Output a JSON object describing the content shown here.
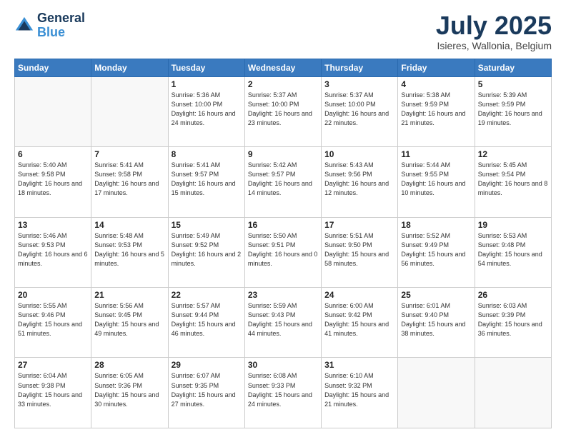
{
  "header": {
    "logo_line1": "General",
    "logo_line2": "Blue",
    "month": "July 2025",
    "location": "Isieres, Wallonia, Belgium"
  },
  "days_of_week": [
    "Sunday",
    "Monday",
    "Tuesday",
    "Wednesday",
    "Thursday",
    "Friday",
    "Saturday"
  ],
  "weeks": [
    [
      {
        "day": "",
        "info": ""
      },
      {
        "day": "",
        "info": ""
      },
      {
        "day": "1",
        "info": "Sunrise: 5:36 AM\nSunset: 10:00 PM\nDaylight: 16 hours\nand 24 minutes."
      },
      {
        "day": "2",
        "info": "Sunrise: 5:37 AM\nSunset: 10:00 PM\nDaylight: 16 hours\nand 23 minutes."
      },
      {
        "day": "3",
        "info": "Sunrise: 5:37 AM\nSunset: 10:00 PM\nDaylight: 16 hours\nand 22 minutes."
      },
      {
        "day": "4",
        "info": "Sunrise: 5:38 AM\nSunset: 9:59 PM\nDaylight: 16 hours\nand 21 minutes."
      },
      {
        "day": "5",
        "info": "Sunrise: 5:39 AM\nSunset: 9:59 PM\nDaylight: 16 hours\nand 19 minutes."
      }
    ],
    [
      {
        "day": "6",
        "info": "Sunrise: 5:40 AM\nSunset: 9:58 PM\nDaylight: 16 hours\nand 18 minutes."
      },
      {
        "day": "7",
        "info": "Sunrise: 5:41 AM\nSunset: 9:58 PM\nDaylight: 16 hours\nand 17 minutes."
      },
      {
        "day": "8",
        "info": "Sunrise: 5:41 AM\nSunset: 9:57 PM\nDaylight: 16 hours\nand 15 minutes."
      },
      {
        "day": "9",
        "info": "Sunrise: 5:42 AM\nSunset: 9:57 PM\nDaylight: 16 hours\nand 14 minutes."
      },
      {
        "day": "10",
        "info": "Sunrise: 5:43 AM\nSunset: 9:56 PM\nDaylight: 16 hours\nand 12 minutes."
      },
      {
        "day": "11",
        "info": "Sunrise: 5:44 AM\nSunset: 9:55 PM\nDaylight: 16 hours\nand 10 minutes."
      },
      {
        "day": "12",
        "info": "Sunrise: 5:45 AM\nSunset: 9:54 PM\nDaylight: 16 hours\nand 8 minutes."
      }
    ],
    [
      {
        "day": "13",
        "info": "Sunrise: 5:46 AM\nSunset: 9:53 PM\nDaylight: 16 hours\nand 6 minutes."
      },
      {
        "day": "14",
        "info": "Sunrise: 5:48 AM\nSunset: 9:53 PM\nDaylight: 16 hours\nand 5 minutes."
      },
      {
        "day": "15",
        "info": "Sunrise: 5:49 AM\nSunset: 9:52 PM\nDaylight: 16 hours\nand 2 minutes."
      },
      {
        "day": "16",
        "info": "Sunrise: 5:50 AM\nSunset: 9:51 PM\nDaylight: 16 hours\nand 0 minutes."
      },
      {
        "day": "17",
        "info": "Sunrise: 5:51 AM\nSunset: 9:50 PM\nDaylight: 15 hours\nand 58 minutes."
      },
      {
        "day": "18",
        "info": "Sunrise: 5:52 AM\nSunset: 9:49 PM\nDaylight: 15 hours\nand 56 minutes."
      },
      {
        "day": "19",
        "info": "Sunrise: 5:53 AM\nSunset: 9:48 PM\nDaylight: 15 hours\nand 54 minutes."
      }
    ],
    [
      {
        "day": "20",
        "info": "Sunrise: 5:55 AM\nSunset: 9:46 PM\nDaylight: 15 hours\nand 51 minutes."
      },
      {
        "day": "21",
        "info": "Sunrise: 5:56 AM\nSunset: 9:45 PM\nDaylight: 15 hours\nand 49 minutes."
      },
      {
        "day": "22",
        "info": "Sunrise: 5:57 AM\nSunset: 9:44 PM\nDaylight: 15 hours\nand 46 minutes."
      },
      {
        "day": "23",
        "info": "Sunrise: 5:59 AM\nSunset: 9:43 PM\nDaylight: 15 hours\nand 44 minutes."
      },
      {
        "day": "24",
        "info": "Sunrise: 6:00 AM\nSunset: 9:42 PM\nDaylight: 15 hours\nand 41 minutes."
      },
      {
        "day": "25",
        "info": "Sunrise: 6:01 AM\nSunset: 9:40 PM\nDaylight: 15 hours\nand 38 minutes."
      },
      {
        "day": "26",
        "info": "Sunrise: 6:03 AM\nSunset: 9:39 PM\nDaylight: 15 hours\nand 36 minutes."
      }
    ],
    [
      {
        "day": "27",
        "info": "Sunrise: 6:04 AM\nSunset: 9:38 PM\nDaylight: 15 hours\nand 33 minutes."
      },
      {
        "day": "28",
        "info": "Sunrise: 6:05 AM\nSunset: 9:36 PM\nDaylight: 15 hours\nand 30 minutes."
      },
      {
        "day": "29",
        "info": "Sunrise: 6:07 AM\nSunset: 9:35 PM\nDaylight: 15 hours\nand 27 minutes."
      },
      {
        "day": "30",
        "info": "Sunrise: 6:08 AM\nSunset: 9:33 PM\nDaylight: 15 hours\nand 24 minutes."
      },
      {
        "day": "31",
        "info": "Sunrise: 6:10 AM\nSunset: 9:32 PM\nDaylight: 15 hours\nand 21 minutes."
      },
      {
        "day": "",
        "info": ""
      },
      {
        "day": "",
        "info": ""
      }
    ]
  ]
}
